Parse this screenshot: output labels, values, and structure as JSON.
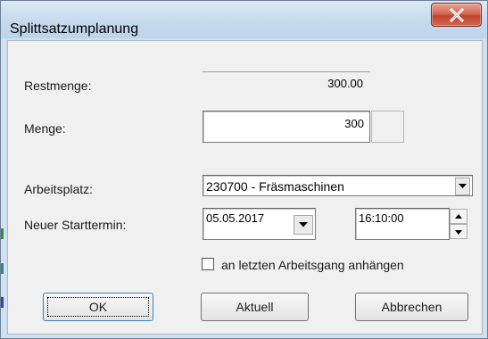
{
  "window": {
    "title": "Splittsatzumplanung"
  },
  "form": {
    "restmenge_label": "Restmenge:",
    "restmenge_value": "300.00",
    "menge_label": "Menge:",
    "menge_value": "300",
    "arbeitsplatz_label": "Arbeitsplatz:",
    "arbeitsplatz_value": "230700 - Fräsmaschinen",
    "starttermin_label": "Neuer Starttermin:",
    "date_value": "05.05.2017",
    "time_value": "16:10:00",
    "checkbox_label": "an letzten Arbeitsgang anhängen",
    "checkbox_checked": false
  },
  "buttons": {
    "ok": "OK",
    "aktuell": "Aktuell",
    "abbrechen": "Abbrechen"
  },
  "icons": {
    "close": "close-icon",
    "dropdown": "chevron-down-icon",
    "spin_up": "chevron-up-icon",
    "spin_down": "chevron-down-icon"
  },
  "colors": {
    "title_bar": "#c6daee",
    "close_button": "#c0442d",
    "dialog_background": "#f0f0f0",
    "default_button_border": "#3c7fb1"
  }
}
